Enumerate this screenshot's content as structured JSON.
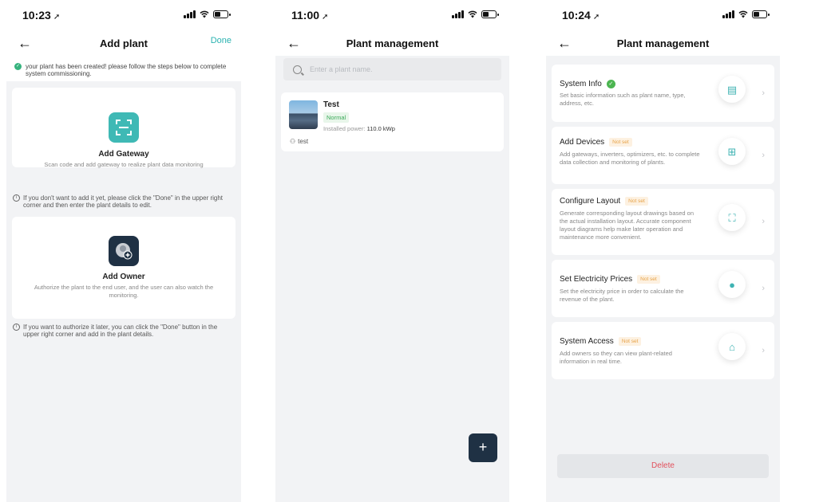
{
  "screen1": {
    "status": {
      "time": "10:23"
    },
    "nav": {
      "title": "Add plant",
      "action": "Done"
    },
    "notice": "your plant has been created! please follow the steps below to complete system commissioning.",
    "gateway": {
      "title": "Add Gateway",
      "desc": "Scan code and add gateway to realize plant data monitoring",
      "icon": "scan-icon"
    },
    "hint1": "If you don't want to add it yet, please click the \"Done\" in the upper right corner and then enter the plant details to edit.",
    "owner": {
      "title": "Add Owner",
      "desc": "Authorize the plant to the end user, and the user can also watch the monitoring.",
      "icon": "owner-icon"
    },
    "hint2": "If you want to authorize it later, you can click the \"Done\" button in the upper right corner and add in the plant details."
  },
  "screen2": {
    "status": {
      "time": "11:00"
    },
    "nav": {
      "title": "Plant management"
    },
    "search": {
      "placeholder": "Enter a plant name."
    },
    "plant": {
      "name": "Test",
      "status": "Normal",
      "power_label": "Installed power: ",
      "power_value": "110.0 kWp",
      "owner": "test"
    },
    "fab": "+"
  },
  "screen3": {
    "status": {
      "time": "10:24"
    },
    "nav": {
      "title": "Plant management"
    },
    "steps": [
      {
        "title": "System Info",
        "badge": "",
        "done": true,
        "desc": "Set basic information such as plant name, type, address, etc.",
        "icon": "document-icon"
      },
      {
        "title": "Add Devices",
        "badge": "Not set",
        "done": false,
        "desc": "Add gateways, inverters, optimizers, etc. to complete data collection and monitoring of plants.",
        "icon": "router-icon"
      },
      {
        "title": "Configure Layout",
        "badge": "Not set",
        "done": false,
        "desc": "Generate corresponding layout drawings based on the actual installation layout. Accurate component layout diagrams help make later operation and maintenance more convenient.",
        "icon": "hierarchy-icon"
      },
      {
        "title": "Set Electricity Prices",
        "badge": "Not set",
        "done": false,
        "desc": "Set the electricity price in order to calculate the revenue of the plant.",
        "icon": "price-icon"
      },
      {
        "title": "System Access",
        "badge": "Not set",
        "done": false,
        "desc": "Add owners so they can view plant-related information in real time.",
        "icon": "access-icon"
      }
    ],
    "delete_label": "Delete"
  },
  "colors": {
    "accent": "#2bb3b1",
    "gateway_icon_bg": "#3fb9b5",
    "owner_icon_bg": "#1f3144",
    "badge_text": "#e7a246",
    "delete_text": "#e2505c"
  }
}
